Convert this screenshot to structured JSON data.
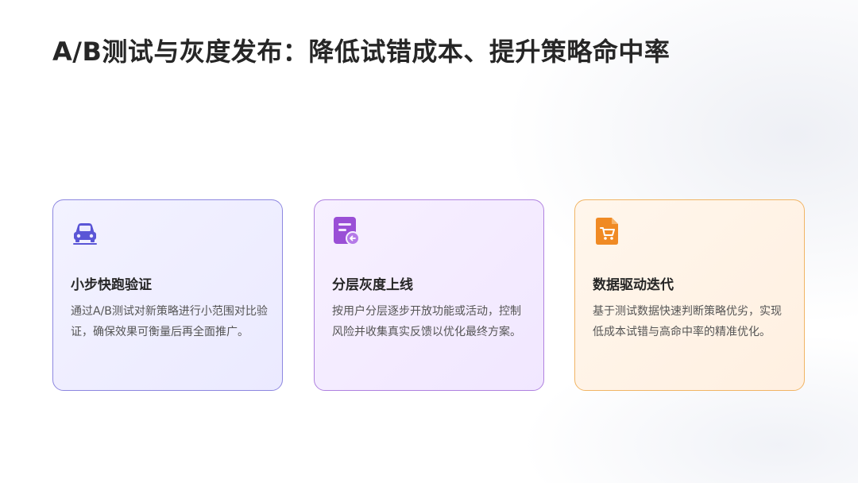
{
  "slide": {
    "title": "A/B测试与灰度发布：降低试错成本、提升策略命中率"
  },
  "cards": [
    {
      "icon": "car-icon",
      "title": "小步快跑验证",
      "description": "通过A/B测试对新策略进行小范围对比验证，确保效果可衡量后再全面推广。",
      "accent": "#5a55d6"
    },
    {
      "icon": "document-return-icon",
      "title": "分层灰度上线",
      "description": "按用户分层逐步开放功能或活动，控制风险并收集真实反馈以优化最终方案。",
      "accent": "#9a4fd6"
    },
    {
      "icon": "shopping-cart-icon",
      "title": "数据驱动迭代",
      "description": "基于测试数据快速判断策略优劣，实现低成本试错与高命中率的精准优化。",
      "accent": "#f08a24"
    }
  ]
}
